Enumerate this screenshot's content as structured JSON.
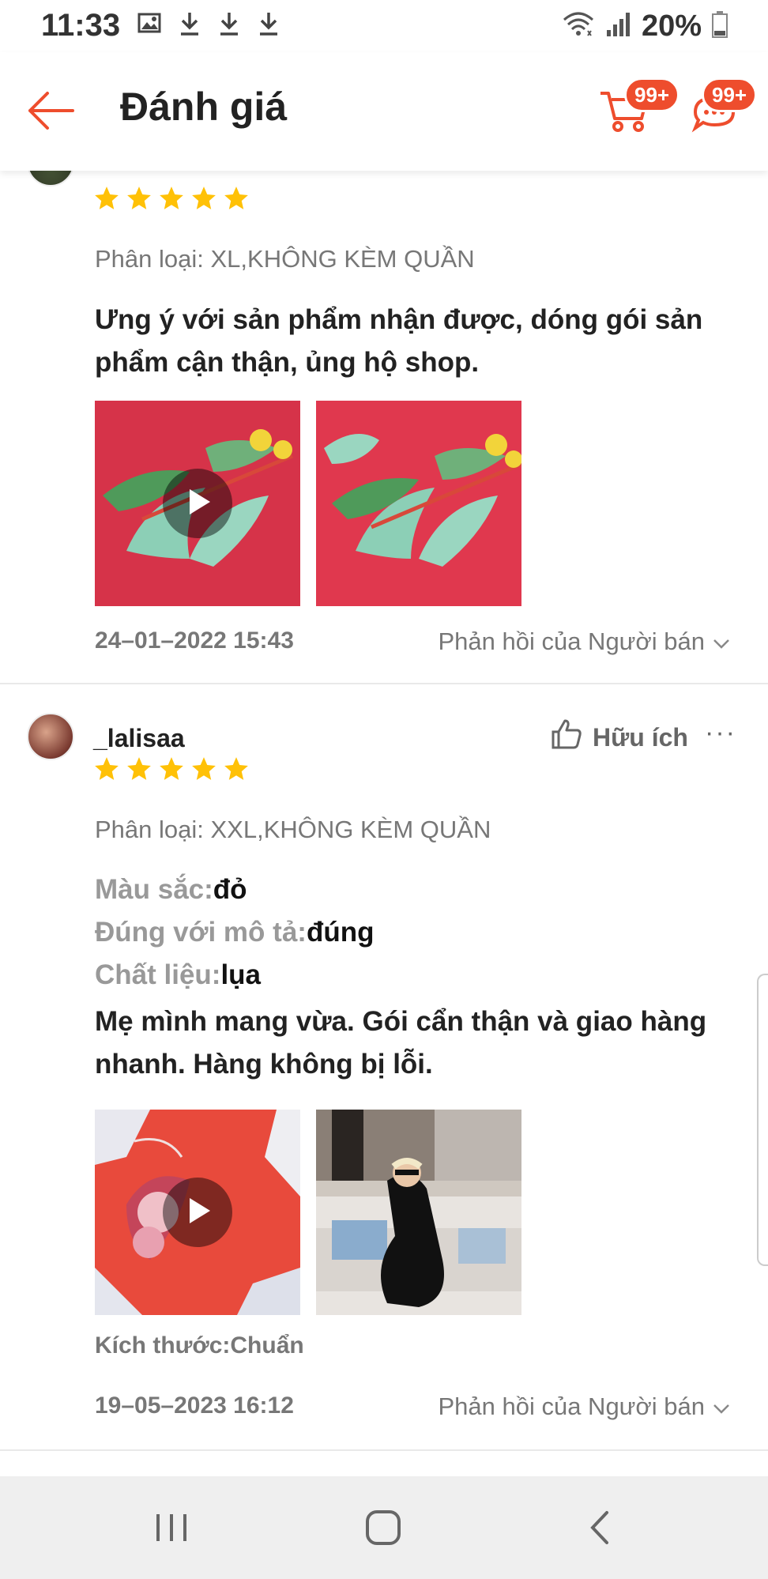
{
  "status_bar": {
    "time": "11:33",
    "battery": "20%",
    "icons": [
      "image-icon",
      "download-icon",
      "download-icon",
      "download-icon",
      "wifi-icon",
      "signal-icon",
      "battery-icon"
    ]
  },
  "header": {
    "title": "Đánh giá",
    "cart_badge": "99+",
    "chat_badge": "99+",
    "accent_color": "#ee4d2d"
  },
  "reviews": [
    {
      "rating": 5,
      "variant": "Phân loại: XL,KHÔNG KÈM QUẦN",
      "text": "Ưng ý với sản phẩm nhận được, dóng gói sản phẩm cận thận, ủng hộ shop.",
      "media": [
        {
          "type": "video",
          "icon": "play-icon"
        },
        {
          "type": "image"
        }
      ],
      "date": "24–01–2022 15:43",
      "reply_label": "Phản hồi của Người bán"
    },
    {
      "username": "_lalisaa",
      "helpful_label": "Hữu ích",
      "rating": 5,
      "variant": "Phân loại: XXL,KHÔNG KÈM QUẦN",
      "attributes": [
        {
          "key": "Màu sắc:",
          "value": "đỏ"
        },
        {
          "key": "Đúng với mô tả:",
          "value": "đúng"
        },
        {
          "key": "Chất liệu:",
          "value": "lụa"
        }
      ],
      "text": "Mẹ mình mang vừa. Gói cẩn thận và giao hàng nhanh. Hàng không bị lỗi.",
      "media": [
        {
          "type": "video",
          "icon": "play-icon"
        },
        {
          "type": "image"
        }
      ],
      "size_line": "Kích thước:Chuẩn",
      "date": "19–05–2023 16:12",
      "reply_label": "Phản hồi của Người bán"
    }
  ],
  "colors": {
    "star": "#ffc107",
    "muted_text": "#777777",
    "nav_background": "#efefef"
  }
}
